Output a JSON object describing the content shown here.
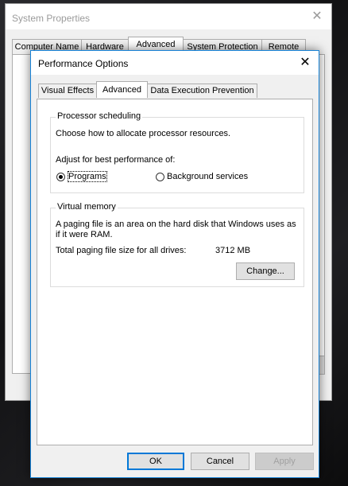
{
  "background_window": {
    "title": "System Properties",
    "close_glyph": "✕",
    "tabs": [
      {
        "label": "Computer Name",
        "active": false
      },
      {
        "label": "Hardware",
        "active": false
      },
      {
        "label": "Advanced",
        "active": true
      },
      {
        "label": "System Protection",
        "active": false
      },
      {
        "label": "Remote",
        "active": false
      }
    ]
  },
  "dialog": {
    "title": "Performance Options",
    "close_glyph": "✕",
    "tabs": [
      {
        "label": "Visual Effects",
        "active": false
      },
      {
        "label": "Advanced",
        "active": true
      },
      {
        "label": "Data Execution Prevention",
        "active": false
      }
    ],
    "processor_scheduling": {
      "legend": "Processor scheduling",
      "description": "Choose how to allocate processor resources.",
      "adjust_label": "Adjust for best performance of:",
      "options": [
        {
          "label": "Programs",
          "selected": true
        },
        {
          "label": "Background services",
          "selected": false
        }
      ]
    },
    "virtual_memory": {
      "legend": "Virtual memory",
      "description_line1": "A paging file is an area on the hard disk that Windows uses as",
      "description_line2": "if it were RAM.",
      "total_label": "Total paging file size for all drives:",
      "total_value": "3712 MB",
      "change_button": "Change..."
    },
    "buttons": {
      "ok": "OK",
      "cancel": "Cancel",
      "apply": "Apply"
    }
  },
  "colors": {
    "accent": "#0078d7",
    "dialog_border": "#1883d7",
    "disabled_text": "#a0a0a0"
  }
}
